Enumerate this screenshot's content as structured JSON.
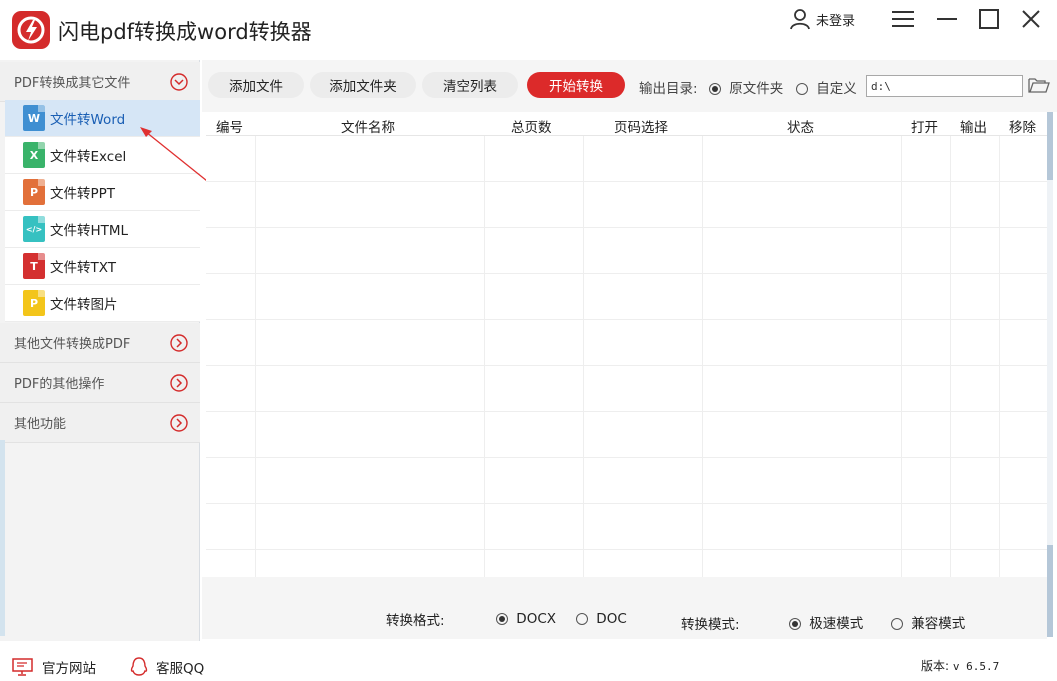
{
  "app": {
    "title": "闪电pdf转换成word转换器",
    "brand_color": "#d42b2b"
  },
  "header": {
    "user_label": "未登录"
  },
  "sidebar": {
    "category_main": "PDF转换成其它文件",
    "items": [
      {
        "label": "文件转Word",
        "icon": "W",
        "color": "#3f8fd2",
        "active": true
      },
      {
        "label": "文件转Excel",
        "icon": "X",
        "color": "#39b36a"
      },
      {
        "label": "文件转PPT",
        "icon": "P",
        "color": "#e2703a"
      },
      {
        "label": "文件转HTML",
        "icon": "</>",
        "color": "#36c1c1"
      },
      {
        "label": "文件转TXT",
        "icon": "T",
        "color": "#d43030"
      },
      {
        "label": "文件转图片",
        "icon": "P",
        "color": "#f3c51a"
      }
    ],
    "categories": [
      "其他文件转换成PDF",
      "PDF的其他操作",
      "其他功能"
    ]
  },
  "toolbar": {
    "add_file": "添加文件",
    "add_folder": "添加文件夹",
    "clear_list": "清空列表",
    "start": "开始转换",
    "output_dir_label": "输出目录:",
    "original_folder": "原文件夹",
    "custom": "自定义",
    "path_value": "d:\\",
    "output_original_selected": true
  },
  "table": {
    "columns": [
      "编号",
      "文件名称",
      "总页数",
      "页码选择",
      "状态",
      "打开",
      "输出",
      "移除"
    ],
    "rows": []
  },
  "options": {
    "format_label": "转换格式:",
    "formats": [
      "DOCX",
      "DOC"
    ],
    "format_selected": "DOCX",
    "mode_label": "转换模式:",
    "modes": [
      "极速模式",
      "兼容模式"
    ],
    "mode_selected": "极速模式"
  },
  "status": {
    "website": "官方网站",
    "support": "客服QQ",
    "version_label": "版本:",
    "version_value": "v 6.5.7"
  }
}
